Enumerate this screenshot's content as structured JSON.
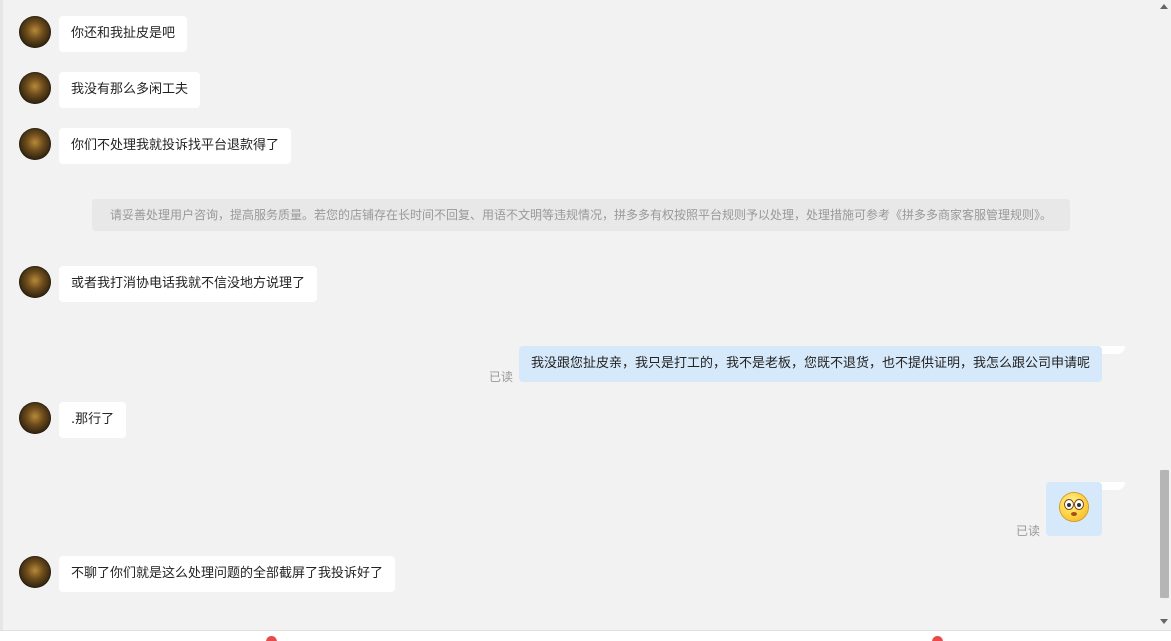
{
  "messages": [
    {
      "text": "你还和我扯皮是吧"
    },
    {
      "text": "我没有那么多闲工夫"
    },
    {
      "text": "你们不处理我就投诉找平台退款得了"
    },
    {
      "text": "请妥善处理用户咨询，提高服务质量。若您的店铺存在长时间不回复、用语不文明等违规情况，拼多多有权按照平台规则予以处理，处理措施可参考《拼多多商家客服管理规则》。"
    },
    {
      "text": "或者我打消协电话我就不信没地方说理了"
    },
    {
      "text": "我没跟您扯皮亲，我只是打工的，我不是老板，您既不退货，也不提供证明，我怎么跟公司申请呢",
      "status": "已读"
    },
    {
      "text": ".那行了"
    },
    {
      "emoji": "flushed-face-emoji",
      "status": "已读"
    },
    {
      "text": "不聊了你们就是这么处理问题的全部截屏了我投诉好了"
    }
  ],
  "colors": {
    "background": "#f2f2f2",
    "incoming_bubble": "#ffffff",
    "outgoing_bubble": "#d6e9fb",
    "read_status": "#999999",
    "notice_background": "#e8e8e8"
  },
  "icons": {
    "avatar": "customer-avatar",
    "emoji": "flushed-face-emoji",
    "badge": "red-dot-badge"
  }
}
